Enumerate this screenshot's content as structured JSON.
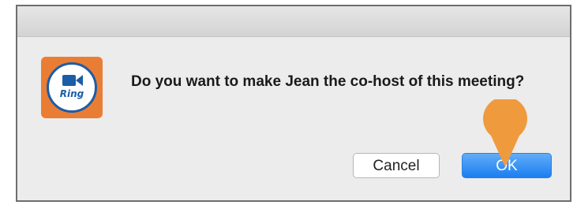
{
  "dialog": {
    "message_part1": "Do you want to make ",
    "message_name": "Jean",
    "message_part2": " the co-host of this meeting?",
    "app_icon": {
      "name": "ringcentral-meetings-icon",
      "label": "Ring",
      "color": "#ea7d34",
      "accent": "#1c5da8"
    },
    "buttons": {
      "cancel_label": "Cancel",
      "ok_label": "OK"
    },
    "annotation": {
      "name": "pointer-marker",
      "color": "#f09a3e",
      "target": "ok"
    }
  }
}
